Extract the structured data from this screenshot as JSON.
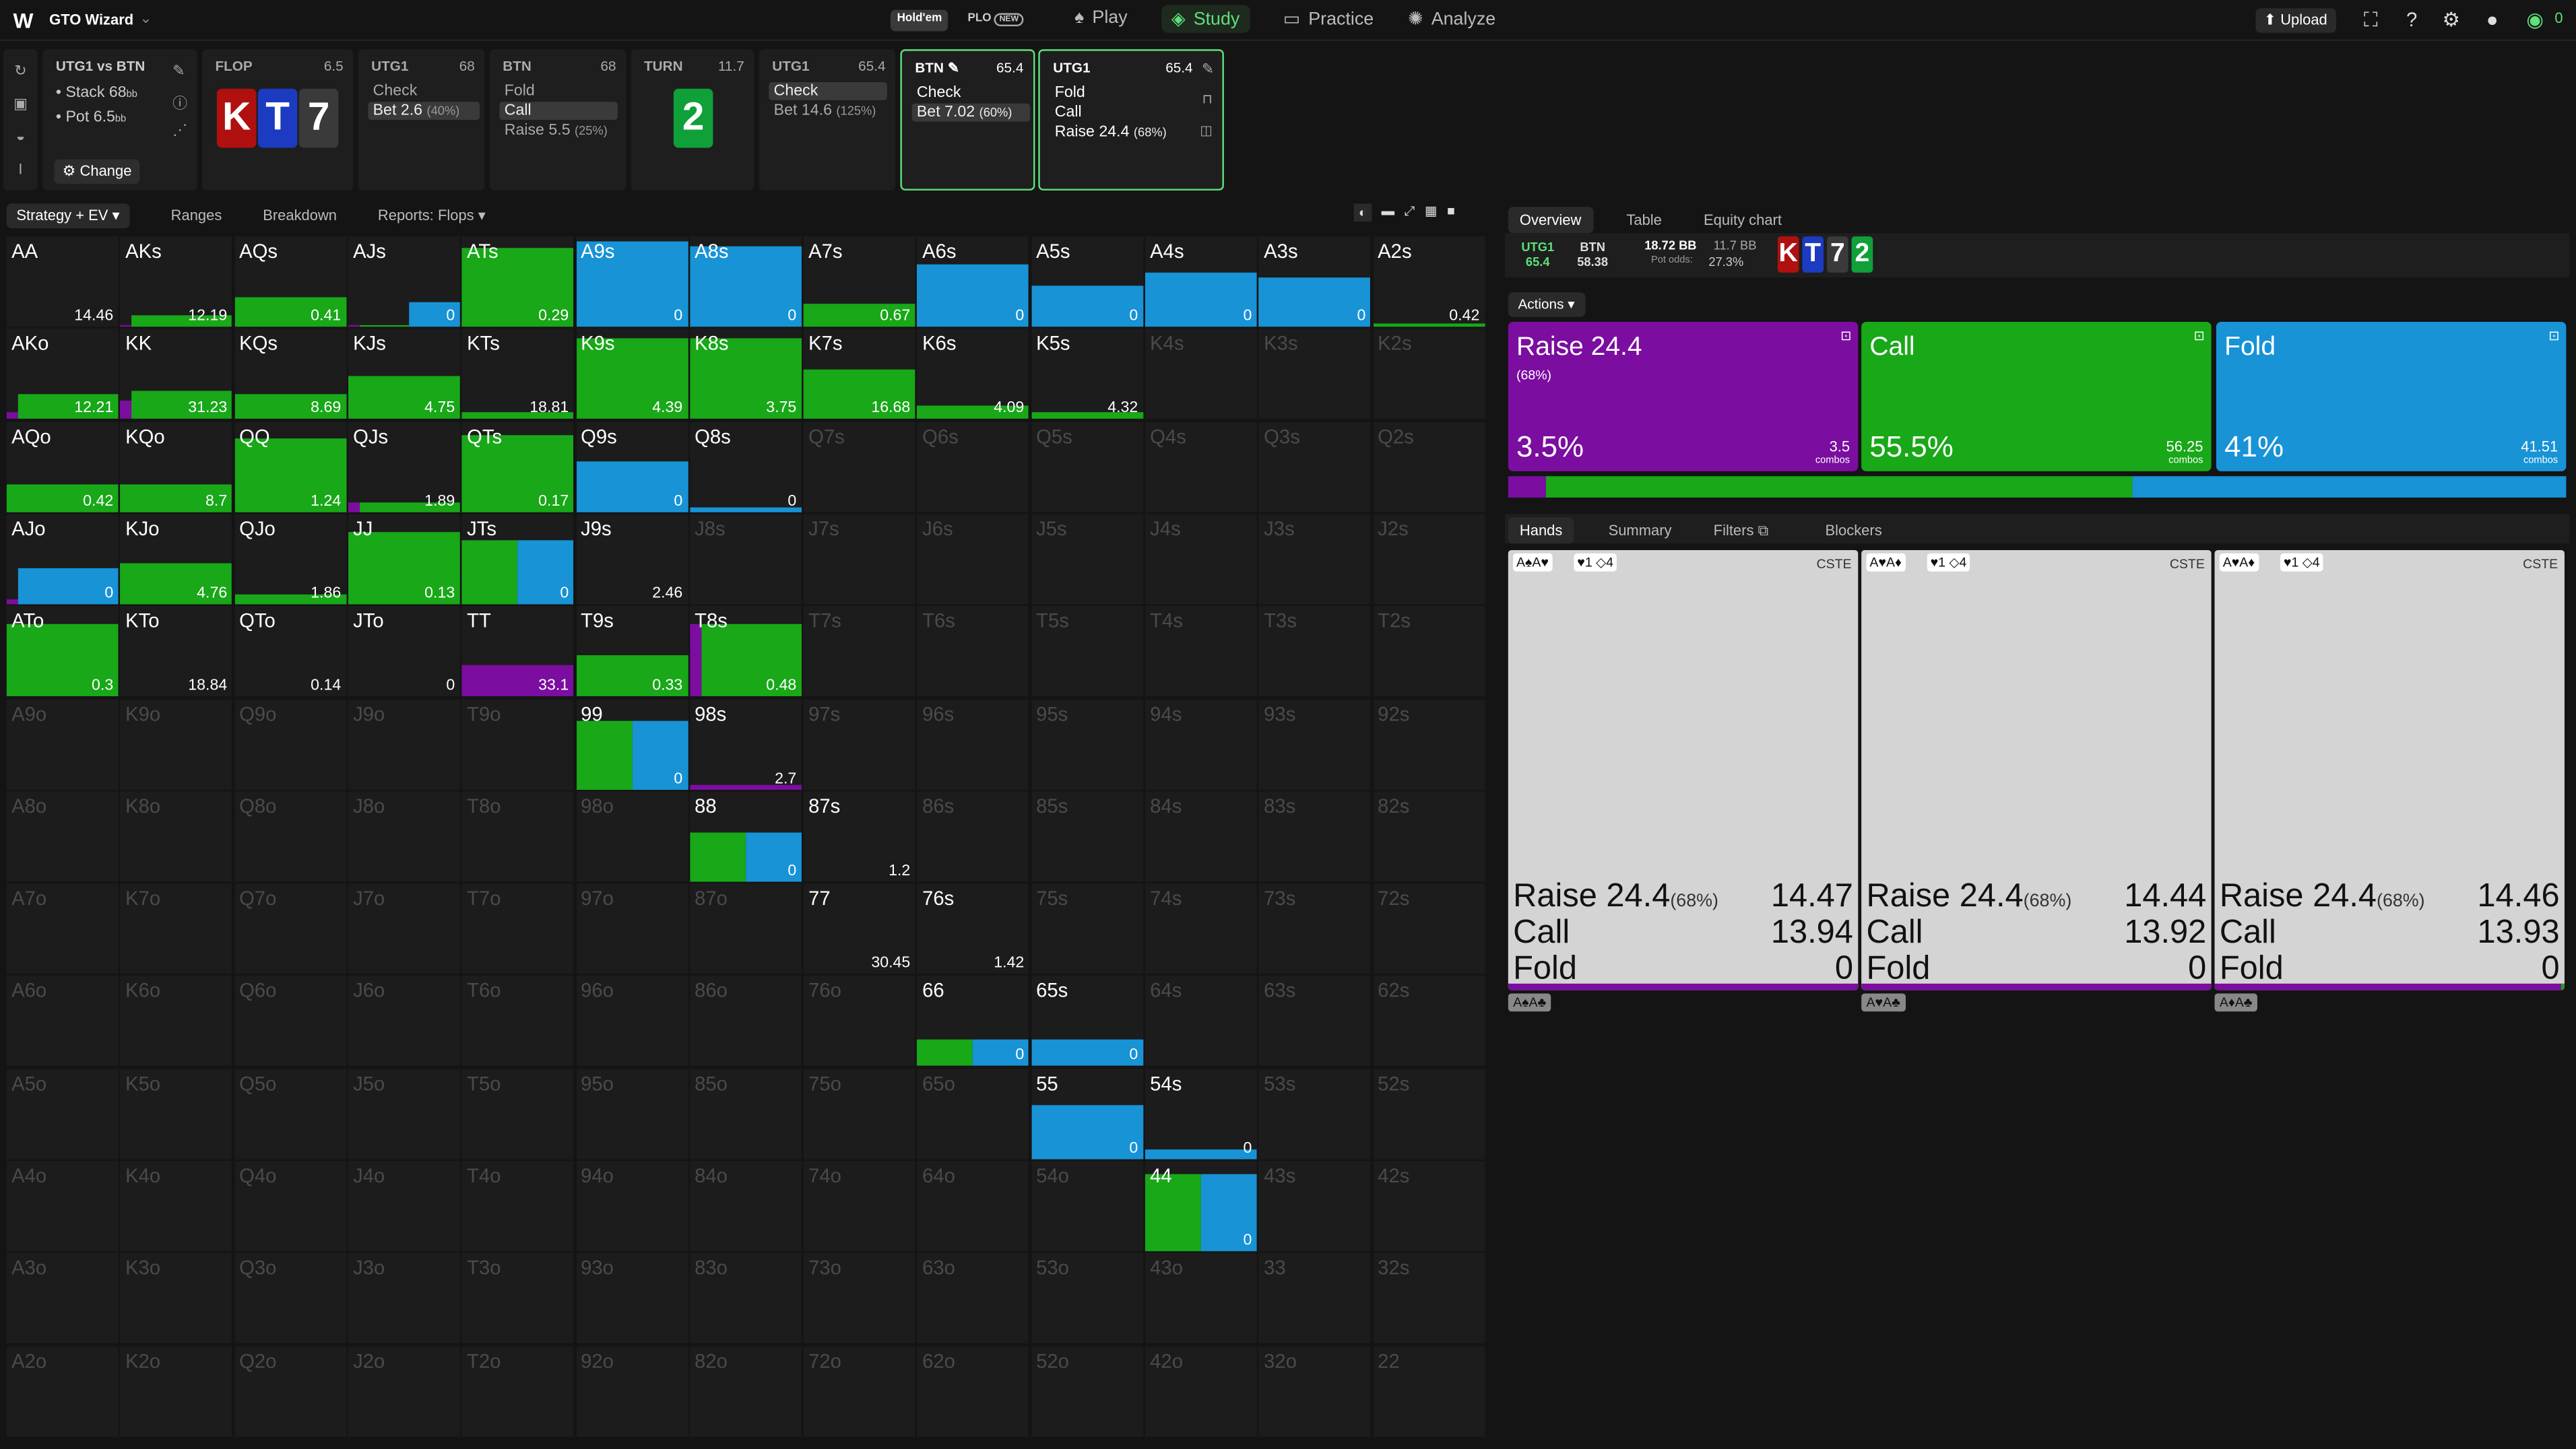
{
  "app": {
    "title": "GTO Wizard",
    "dropdown_icon": "chevron-down-icon"
  },
  "nav": {
    "holdem": "Hold'em",
    "plo": "PLO",
    "plo_badge": "NEW",
    "items": [
      {
        "label": "Play",
        "icon": "spade-icon"
      },
      {
        "label": "Study",
        "icon": "layers-icon"
      },
      {
        "label": "Practice",
        "icon": "controller-icon"
      },
      {
        "label": "Analyze",
        "icon": "bulb-icon"
      }
    ],
    "upload": "Upload",
    "coins": "0"
  },
  "summary": {
    "title": "UTG1 vs BTN",
    "stack_label": "Stack 68",
    "stack_unit": "bb",
    "pot_label": "Pot 6.5",
    "pot_unit": "bb",
    "change": "Change"
  },
  "flop": {
    "title": "FLOP",
    "num": "6.5",
    "cards": [
      {
        "rank": "K",
        "color": "#b01010"
      },
      {
        "rank": "T",
        "color": "#1c3bc0"
      },
      {
        "rank": "7",
        "color": "#3a3a3a"
      }
    ]
  },
  "turn": {
    "title": "TURN",
    "num": "11.7",
    "card": {
      "rank": "2",
      "color": "#0fa03a"
    }
  },
  "actions_cards": [
    {
      "title": "UTG1",
      "num": "68",
      "opts": [
        {
          "label": "Check",
          "pct": ""
        },
        {
          "label": "Bet 2.6",
          "pct": "(40%)"
        }
      ]
    },
    {
      "title": "BTN",
      "num": "68",
      "opts": [
        {
          "label": "Fold",
          "pct": ""
        },
        {
          "label": "Call",
          "pct": ""
        },
        {
          "label": "Raise 5.5",
          "pct": "(25%)"
        }
      ]
    },
    {
      "title": "UTG1",
      "num": "65.4",
      "opts": [
        {
          "label": "Check",
          "pct": ""
        },
        {
          "label": "Bet 14.6",
          "pct": "(125%)"
        }
      ]
    },
    {
      "title": "BTN",
      "num": "65.4",
      "opts": [
        {
          "label": "Check",
          "pct": ""
        },
        {
          "label": "Bet 7.02",
          "pct": "(60%)"
        }
      ]
    },
    {
      "title": "UTG1",
      "num": "65.4",
      "opts": [
        {
          "label": "Fold",
          "pct": ""
        },
        {
          "label": "Call",
          "pct": ""
        },
        {
          "label": "Raise 24.4",
          "pct": "(68%)"
        }
      ]
    }
  ],
  "left_tabs": [
    "Strategy + EV",
    "Ranges",
    "Breakdown",
    "Reports: Flops"
  ],
  "colors": {
    "raise": "#7b0da0",
    "call": "#18a818",
    "fold": "#1793d6",
    "cell_bg": "#1c1c1c"
  },
  "grid": [
    [
      "AA",
      "AKs",
      "AQs",
      "AJs",
      "ATs",
      "A9s",
      "A8s",
      "A7s",
      "A6s",
      "A5s",
      "A4s",
      "A3s",
      "A2s"
    ],
    [
      "AKo",
      "KK",
      "KQs",
      "KJs",
      "KTs",
      "K9s",
      "K8s",
      "K7s",
      "K6s",
      "K5s",
      "K4s",
      "K3s",
      "K2s"
    ],
    [
      "AQo",
      "KQo",
      "QQ",
      "QJs",
      "QTs",
      "Q9s",
      "Q8s",
      "Q7s",
      "Q6s",
      "Q5s",
      "Q4s",
      "Q3s",
      "Q2s"
    ],
    [
      "AJo",
      "KJo",
      "QJo",
      "JJ",
      "JTs",
      "J9s",
      "J8s",
      "J7s",
      "J6s",
      "J5s",
      "J4s",
      "J3s",
      "J2s"
    ],
    [
      "ATo",
      "KTo",
      "QTo",
      "JTo",
      "TT",
      "T9s",
      "T8s",
      "T7s",
      "T6s",
      "T5s",
      "T4s",
      "T3s",
      "T2s"
    ],
    [
      "A9o",
      "K9o",
      "Q9o",
      "J9o",
      "T9o",
      "99",
      "98s",
      "97s",
      "96s",
      "95s",
      "94s",
      "93s",
      "92s"
    ],
    [
      "A8o",
      "K8o",
      "Q8o",
      "J8o",
      "T8o",
      "98o",
      "88",
      "87s",
      "86s",
      "85s",
      "84s",
      "83s",
      "82s"
    ],
    [
      "A7o",
      "K7o",
      "Q7o",
      "J7o",
      "T7o",
      "97o",
      "87o",
      "77",
      "76s",
      "75s",
      "74s",
      "73s",
      "72s"
    ],
    [
      "A6o",
      "K6o",
      "Q6o",
      "J6o",
      "T6o",
      "96o",
      "86o",
      "76o",
      "66",
      "65s",
      "64s",
      "63s",
      "62s"
    ],
    [
      "A5o",
      "K5o",
      "Q5o",
      "J5o",
      "T5o",
      "95o",
      "85o",
      "75o",
      "65o",
      "55",
      "54s",
      "53s",
      "52s"
    ],
    [
      "A4o",
      "K4o",
      "Q4o",
      "J4o",
      "T4o",
      "94o",
      "84o",
      "74o",
      "64o",
      "54o",
      "44",
      "43s",
      "42s"
    ],
    [
      "A3o",
      "K3o",
      "Q3o",
      "J3o",
      "T3o",
      "93o",
      "83o",
      "73o",
      "63o",
      "53o",
      "43o",
      "33",
      "32s"
    ],
    [
      "A2o",
      "K2o",
      "Q2o",
      "J2o",
      "T2o",
      "92o",
      "82o",
      "72o",
      "62o",
      "52o",
      "42o",
      "32o",
      "22"
    ]
  ],
  "cells": {
    "AA": {
      "ev": "14.46",
      "segs": []
    },
    "AKs": {
      "ev": "12.19",
      "segs": [
        [
          "raise",
          0.02
        ],
        [
          "call",
          0.12
        ]
      ]
    },
    "AQs": {
      "ev": "0.41",
      "segs": [
        [
          "call",
          0.32
        ]
      ]
    },
    "AJs": {
      "ev": "0",
      "segs": [
        [
          "raise",
          0.02
        ],
        [
          "call",
          0.02
        ],
        [
          "fold",
          0.28
        ]
      ]
    },
    "ATs": {
      "ev": "0.29",
      "segs": [
        [
          "call",
          0.87
        ]
      ]
    },
    "A9s": {
      "ev": "0",
      "segs": [
        [
          "fold",
          0.95
        ]
      ]
    },
    "A8s": {
      "ev": "0",
      "segs": [
        [
          "fold",
          0.9
        ]
      ]
    },
    "A7s": {
      "ev": "0.67",
      "segs": [
        [
          "call",
          0.25
        ]
      ]
    },
    "A6s": {
      "ev": "0",
      "segs": [
        [
          "fold",
          0.7
        ]
      ]
    },
    "A5s": {
      "ev": "0",
      "segs": [
        [
          "fold",
          0.45
        ]
      ]
    },
    "A4s": {
      "ev": "0",
      "segs": [
        [
          "fold",
          0.6
        ]
      ]
    },
    "A3s": {
      "ev": "0",
      "segs": [
        [
          "fold",
          0.55
        ]
      ]
    },
    "A2s": {
      "ev": "0.42",
      "segs": [
        [
          "call",
          0.03
        ]
      ]
    },
    "AKo": {
      "ev": "12.21",
      "segs": [
        [
          "raise",
          0.07
        ],
        [
          "call",
          0.28
        ]
      ]
    },
    "KK": {
      "ev": "31.23",
      "segs": [
        [
          "raise",
          0.2
        ],
        [
          "call",
          0.32
        ]
      ]
    },
    "KQs": {
      "ev": "8.69",
      "segs": [
        [
          "call",
          0.28
        ]
      ]
    },
    "KJs": {
      "ev": "4.75",
      "segs": [
        [
          "call",
          0.48
        ]
      ]
    },
    "KTs": {
      "ev": "18.81",
      "segs": [
        [
          "call",
          0.08
        ]
      ]
    },
    "K9s": {
      "ev": "4.39",
      "segs": [
        [
          "call",
          0.9
        ]
      ]
    },
    "K8s": {
      "ev": "3.75",
      "segs": [
        [
          "call",
          0.9
        ]
      ]
    },
    "K7s": {
      "ev": "16.68",
      "segs": [
        [
          "call",
          0.55
        ]
      ]
    },
    "K6s": {
      "ev": "4.09",
      "segs": [
        [
          "call",
          0.15
        ]
      ]
    },
    "K5s": {
      "ev": "4.32",
      "segs": [
        [
          "call",
          0.08
        ]
      ]
    },
    "AQo": {
      "ev": "0.42",
      "segs": [
        [
          "call",
          0.3
        ]
      ]
    },
    "KQo": {
      "ev": "8.7",
      "segs": [
        [
          "call",
          0.3
        ]
      ]
    },
    "QQ": {
      "ev": "1.24",
      "segs": [
        [
          "call",
          0.82
        ]
      ]
    },
    "QJs": {
      "ev": "1.89",
      "segs": [
        [
          "raise",
          0.1
        ],
        [
          "call",
          0.1
        ]
      ]
    },
    "QTs": {
      "ev": "0.17",
      "segs": [
        [
          "call",
          0.85
        ]
      ]
    },
    "Q9s": {
      "ev": "0",
      "segs": [
        [
          "fold",
          0.55
        ]
      ]
    },
    "Q8s": {
      "ev": "0",
      "segs": [
        [
          "fold",
          0.05
        ]
      ]
    },
    "AJo": {
      "ev": "0",
      "segs": [
        [
          "raise",
          0.05
        ],
        [
          "fold",
          0.4
        ]
      ]
    },
    "KJo": {
      "ev": "4.76",
      "segs": [
        [
          "call",
          0.45
        ]
      ]
    },
    "QJo": {
      "ev": "1.86",
      "segs": [
        [
          "call",
          0.1
        ]
      ]
    },
    "JJ": {
      "ev": "0.13",
      "segs": [
        [
          "call",
          0.8
        ]
      ]
    },
    "JTs": {
      "ev": "0",
      "segs": [
        [
          "call",
          0.7
        ],
        [
          "fold",
          0.7
        ]
      ]
    },
    "J9s": {
      "ev": "2.46",
      "segs": []
    },
    "ATo": {
      "ev": "0.3",
      "segs": [
        [
          "call",
          0.8
        ]
      ]
    },
    "KTo": {
      "ev": "18.84",
      "segs": []
    },
    "QTo": {
      "ev": "0.14",
      "segs": []
    },
    "JTo": {
      "ev": "0",
      "segs": []
    },
    "TT": {
      "ev": "33.1",
      "segs": [
        [
          "raise",
          0.35
        ]
      ]
    },
    "T9s": {
      "ev": "0.33",
      "segs": [
        [
          "call",
          0.45
        ]
      ]
    },
    "T8s": {
      "ev": "0.48",
      "segs": [
        [
          "raise",
          0.8
        ],
        [
          "call",
          0.8
        ]
      ]
    },
    "99": {
      "ev": "0",
      "segs": [
        [
          "call",
          0.75
        ],
        [
          "fold",
          0.75
        ]
      ]
    },
    "98s": {
      "ev": "2.7",
      "segs": [
        [
          "raise",
          0.05
        ]
      ]
    },
    "88": {
      "ev": "0",
      "segs": [
        [
          "call",
          0.55
        ],
        [
          "fold",
          0.55
        ]
      ]
    },
    "87s": {
      "ev": "1.2",
      "segs": []
    },
    "77": {
      "ev": "30.45",
      "segs": []
    },
    "76s": {
      "ev": "1.42",
      "segs": []
    },
    "66": {
      "ev": "0",
      "segs": [
        [
          "call",
          0.3
        ],
        [
          "fold",
          0.3
        ]
      ]
    },
    "65s": {
      "ev": "0",
      "segs": [
        [
          "fold",
          0.3
        ]
      ]
    },
    "55": {
      "ev": "0",
      "segs": [
        [
          "fold",
          0.6
        ]
      ]
    },
    "54s": {
      "ev": "0",
      "segs": [
        [
          "fold",
          0.1
        ]
      ]
    },
    "44": {
      "ev": "0",
      "segs": [
        [
          "call",
          0.85
        ],
        [
          "fold",
          0.85
        ]
      ]
    }
  },
  "right": {
    "tabs": [
      "Overview",
      "Table",
      "Equity chart"
    ],
    "utg1_label": "UTG1",
    "utg1_val": "65.4",
    "btn_label": "BTN",
    "btn_val": "58.38",
    "pot_bb": "18.72 BB",
    "pot_bb2": "11.7 BB",
    "pot_odds_label": "Pot odds:",
    "pot_odds": "27.3%",
    "board": [
      {
        "rank": "K",
        "color": "#b01010"
      },
      {
        "rank": "T",
        "color": "#1c3bc0"
      },
      {
        "rank": "7",
        "color": "#3a3a3a"
      },
      {
        "rank": "2",
        "color": "#0fa03a"
      }
    ],
    "actions_label": "Actions",
    "action_boxes": [
      {
        "name": "Raise 24.4",
        "sub": "(68%)",
        "freq": "3.5%",
        "combos": "3.5",
        "combos_label": "combos",
        "color": "#7b0da0"
      },
      {
        "name": "Call",
        "sub": "",
        "freq": "55.5%",
        "combos": "56.25",
        "combos_label": "combos",
        "color": "#18a818"
      },
      {
        "name": "Fold",
        "sub": "",
        "freq": "41%",
        "combos": "41.51",
        "combos_label": "combos",
        "color": "#1793d6"
      }
    ],
    "freq_bar": {
      "raise": 0.035,
      "call": 0.555,
      "fold": 0.41
    },
    "sub_tabs": [
      "Hands",
      "Summary",
      "Filters",
      "Blockers"
    ],
    "hand_cards": [
      {
        "hand": "A♠A♥",
        "blockers": "♥1 ◇4",
        "tag": "CSTE",
        "raise_label": "Raise 24.4",
        "raise_pct": "(68%)",
        "raise_ev": "14.47",
        "call_label": "Call",
        "call_ev": "13.94",
        "fold_label": "Fold",
        "fold_ev": "0",
        "combo": "A♠A♣"
      },
      {
        "hand": "A♥A♦",
        "blockers": "♥1 ◇4",
        "tag": "CSTE",
        "raise_label": "Raise 24.4",
        "raise_pct": "(68%)",
        "raise_ev": "14.44",
        "call_label": "Call",
        "call_ev": "13.92",
        "fold_label": "Fold",
        "fold_ev": "0",
        "combo": "A♥A♣"
      },
      {
        "hand": "A♥A♦",
        "blockers": "♥1 ◇4",
        "tag": "CSTE",
        "raise_label": "Raise 24.4",
        "raise_pct": "(68%)",
        "raise_ev": "14.46",
        "call_label": "Call",
        "call_ev": "13.93",
        "fold_label": "Fold",
        "fold_ev": "0",
        "combo": "A♦A♣"
      }
    ]
  }
}
